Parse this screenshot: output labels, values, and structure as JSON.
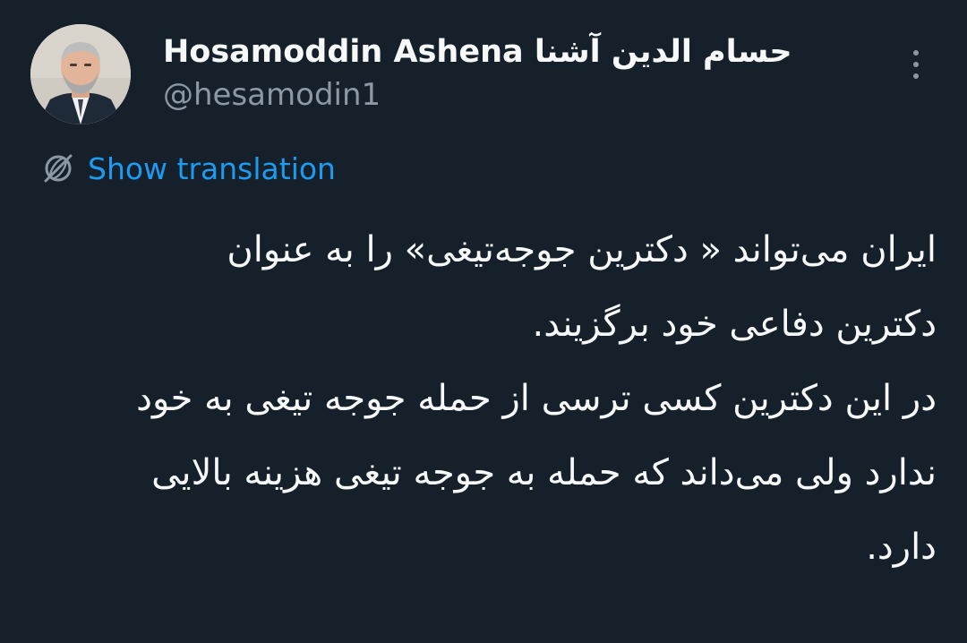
{
  "tweet": {
    "author": {
      "name_latin": "Hosamoddin Ashena",
      "name_persian": "حسام الدین آشنا",
      "handle": "@hesamodin1"
    },
    "more_icon": "more-vertical-icon",
    "translate": {
      "icon": "translate-globe-icon",
      "label": "Show translation"
    },
    "body_lines": [
      "ایران  می‌تواند « دکترین جوجه‌تیغی» را به عنوان",
      "دکترین دفاعی خود برگزیند.",
      "در این دکترین کسی ترسی از حمله جوجه تیغی به خود",
      "ندارد ولی می‌داند که حمله به جوجه تیغی هزینه بالایی",
      "دارد."
    ]
  },
  "colors": {
    "background": "#15202b",
    "text_primary": "#f7f9f9",
    "text_secondary": "#8b98a5",
    "link": "#1d9bf0"
  }
}
